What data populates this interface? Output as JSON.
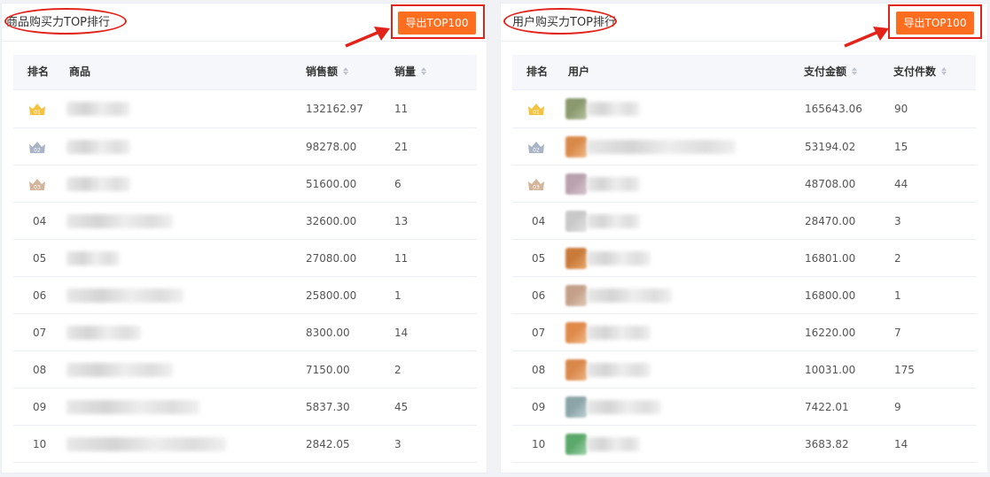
{
  "colors": {
    "accent": "#ff6d1f",
    "annotation": "#e2231a",
    "gold": "#f5c342",
    "silver": "#a9b4c7",
    "bronze": "#d4b69c"
  },
  "icons": {
    "rank_1": "crown-gold-icon",
    "rank_2": "crown-silver-icon",
    "rank_3": "crown-bronze-icon",
    "sort": "sort-caret-icon",
    "arrow": "red-arrow-icon"
  },
  "product_panel": {
    "title": "商品购买力TOP排行",
    "export_label": "导出TOP100",
    "columns": {
      "rank": "排名",
      "name": "商品",
      "sales": "销售额",
      "qty": "销量"
    },
    "rows": [
      {
        "rank": "01",
        "badge": "01",
        "sales": "132162.97",
        "qty": "11"
      },
      {
        "rank": "02",
        "badge": "02",
        "sales": "98278.00",
        "qty": "21"
      },
      {
        "rank": "03",
        "badge": "03",
        "sales": "51600.00",
        "qty": "6"
      },
      {
        "rank": "04",
        "sales": "32600.00",
        "qty": "13"
      },
      {
        "rank": "05",
        "sales": "27080.00",
        "qty": "11"
      },
      {
        "rank": "06",
        "sales": "25800.00",
        "qty": "1"
      },
      {
        "rank": "07",
        "sales": "8300.00",
        "qty": "14"
      },
      {
        "rank": "08",
        "sales": "7150.00",
        "qty": "2"
      },
      {
        "rank": "09",
        "sales": "5837.30",
        "qty": "45"
      },
      {
        "rank": "10",
        "sales": "2842.05",
        "qty": "3"
      }
    ]
  },
  "user_panel": {
    "title": "用户购买力TOP排行",
    "export_label": "导出TOP100",
    "columns": {
      "rank": "排名",
      "name": "用户",
      "amount": "支付金额",
      "count": "支付件数"
    },
    "rows": [
      {
        "rank": "01",
        "badge": "01",
        "amount": "165643.06",
        "count": "90"
      },
      {
        "rank": "02",
        "badge": "02",
        "amount": "53194.02",
        "count": "15"
      },
      {
        "rank": "03",
        "badge": "03",
        "amount": "48708.00",
        "count": "44"
      },
      {
        "rank": "04",
        "amount": "28470.00",
        "count": "3"
      },
      {
        "rank": "05",
        "amount": "16801.00",
        "count": "2"
      },
      {
        "rank": "06",
        "amount": "16800.00",
        "count": "1"
      },
      {
        "rank": "07",
        "amount": "16220.00",
        "count": "7"
      },
      {
        "rank": "08",
        "amount": "10031.00",
        "count": "175"
      },
      {
        "rank": "09",
        "amount": "7422.01",
        "count": "9"
      },
      {
        "rank": "10",
        "amount": "3683.82",
        "count": "14"
      }
    ]
  }
}
